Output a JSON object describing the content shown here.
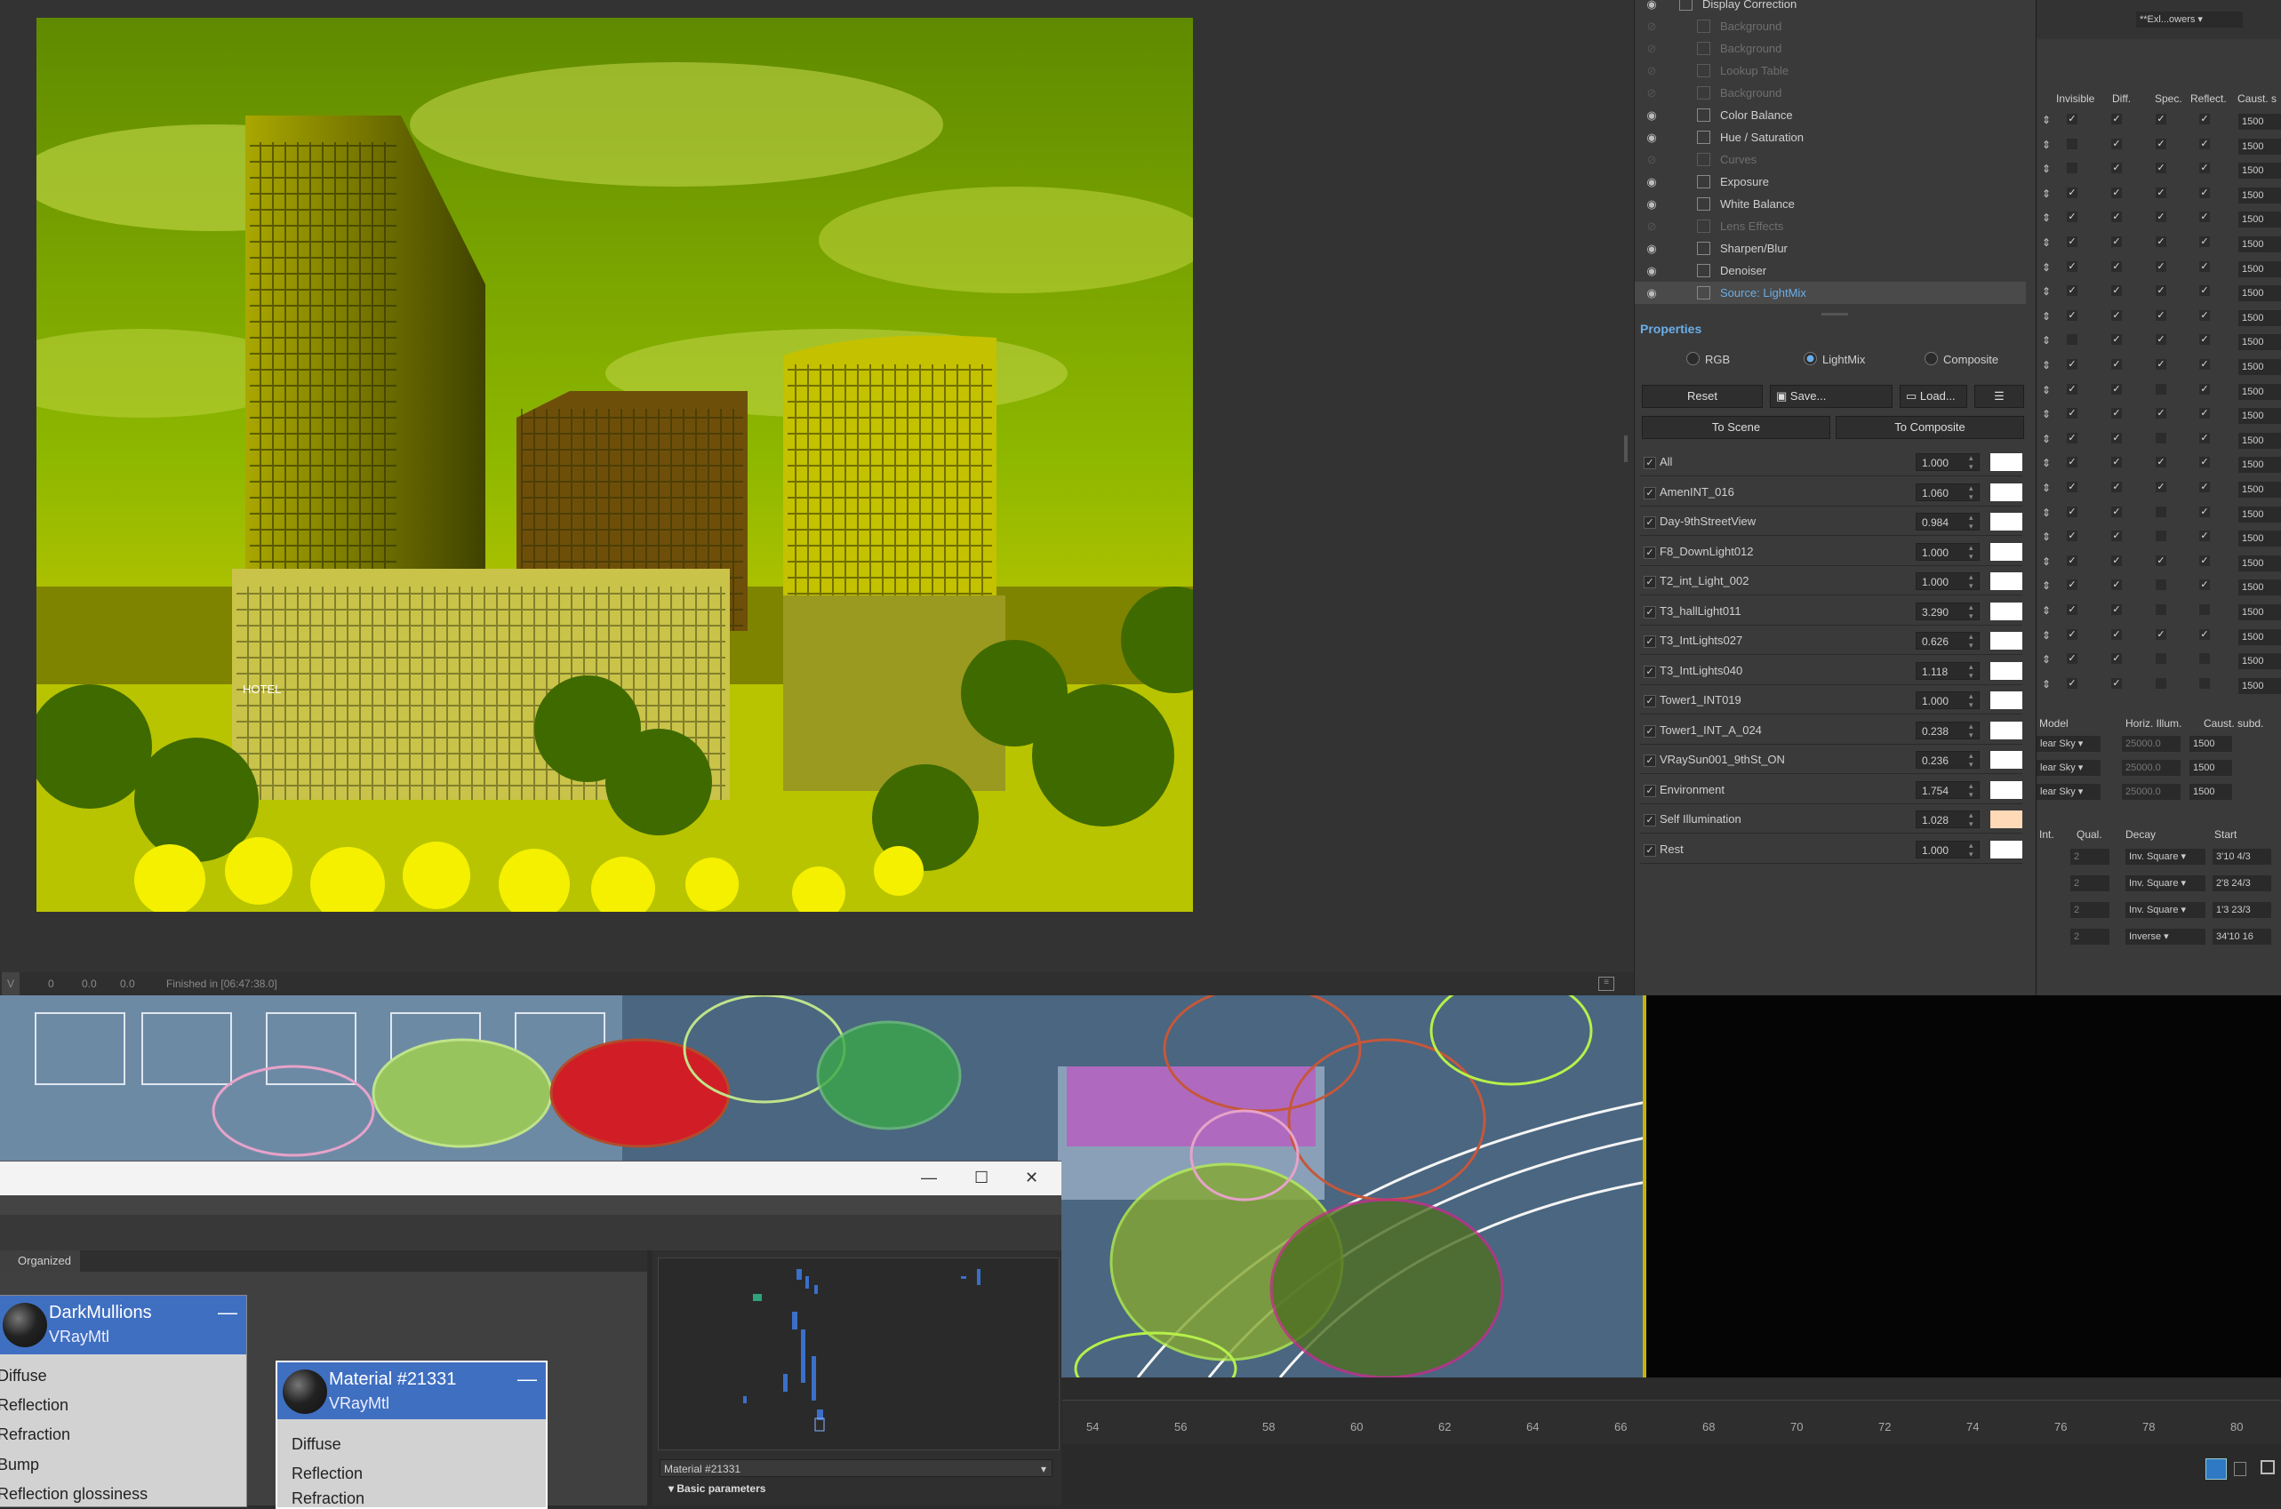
{
  "vfb": {
    "status": {
      "mode": "V",
      "v1": "0",
      "v2": "0.0",
      "v3": "0.0",
      "finished": "Finished in [06:47:38.0]"
    },
    "render_sign": "HOTEL"
  },
  "layers": [
    {
      "name": "Display Correction",
      "visible": true,
      "dim": false
    },
    {
      "name": "Background",
      "visible": false,
      "dim": true
    },
    {
      "name": "Background",
      "visible": false,
      "dim": true
    },
    {
      "name": "Lookup Table",
      "visible": false,
      "dim": true
    },
    {
      "name": "Background",
      "visible": false,
      "dim": true
    },
    {
      "name": "Color Balance",
      "visible": true,
      "dim": false
    },
    {
      "name": "Hue / Saturation",
      "visible": true,
      "dim": false
    },
    {
      "name": "Curves",
      "visible": false,
      "dim": true
    },
    {
      "name": "Exposure",
      "visible": true,
      "dim": false
    },
    {
      "name": "White Balance",
      "visible": true,
      "dim": false
    },
    {
      "name": "Lens Effects",
      "visible": false,
      "dim": true
    },
    {
      "name": "Sharpen/Blur",
      "visible": true,
      "dim": false
    },
    {
      "name": "Denoiser",
      "visible": true,
      "dim": false
    },
    {
      "name": "Source: LightMix",
      "visible": true,
      "dim": false,
      "selected": true
    }
  ],
  "properties": {
    "header": "Properties",
    "modes": [
      "RGB",
      "LightMix",
      "Composite"
    ],
    "selected_mode": "LightMix",
    "buttons": {
      "reset": "Reset",
      "save": "Save...",
      "load": "Load...",
      "to_scene": "To Scene",
      "to_composite": "To Composite"
    },
    "lightmix": [
      {
        "name": "All",
        "value": "1.000",
        "color": "#ffffff"
      },
      {
        "name": "AmenINT_016",
        "value": "1.060",
        "color": "#ffffff"
      },
      {
        "name": "Day-9thStreetView",
        "value": "0.984",
        "color": "#ffffff"
      },
      {
        "name": "F8_DownLight012",
        "value": "1.000",
        "color": "#ffffff"
      },
      {
        "name": "T2_int_Light_002",
        "value": "1.000",
        "color": "#ffffff"
      },
      {
        "name": "T3_hallLight011",
        "value": "3.290",
        "color": "#ffffff"
      },
      {
        "name": "T3_IntLights027",
        "value": "0.626",
        "color": "#ffffff"
      },
      {
        "name": "T3_IntLights040",
        "value": "1.118",
        "color": "#ffffff"
      },
      {
        "name": "Tower1_INT019",
        "value": "1.000",
        "color": "#ffffff"
      },
      {
        "name": "Tower1_INT_A_024",
        "value": "0.238",
        "color": "#ffffff"
      },
      {
        "name": "VRaySun001_9thSt_ON",
        "value": "0.236",
        "color": "#ffffff"
      },
      {
        "name": "Environment",
        "value": "1.754",
        "color": "#ffffff"
      },
      {
        "name": "Self Illumination",
        "value": "1.028",
        "color": "#ffd9b8"
      },
      {
        "name": "Rest",
        "value": "1.000",
        "color": "#ffffff"
      }
    ]
  },
  "lister": {
    "dropdown": "**Exl...owers",
    "headers": [
      "Invisible",
      "Diff.",
      "Spec.",
      "Reflect.",
      "Caust. s"
    ],
    "rows": [
      {
        "inv": true,
        "diff": true,
        "spec": true,
        "refl": true,
        "caust": "1500"
      },
      {
        "inv": false,
        "diff": true,
        "spec": true,
        "refl": true,
        "caust": "1500"
      },
      {
        "inv": false,
        "diff": true,
        "spec": true,
        "refl": true,
        "caust": "1500"
      },
      {
        "inv": true,
        "diff": true,
        "spec": true,
        "refl": true,
        "caust": "1500"
      },
      {
        "inv": true,
        "diff": true,
        "spec": true,
        "refl": true,
        "caust": "1500"
      },
      {
        "inv": true,
        "diff": true,
        "spec": true,
        "refl": true,
        "caust": "1500"
      },
      {
        "inv": true,
        "diff": true,
        "spec": true,
        "refl": true,
        "caust": "1500"
      },
      {
        "inv": true,
        "diff": true,
        "spec": true,
        "refl": true,
        "caust": "1500"
      },
      {
        "inv": true,
        "diff": true,
        "spec": true,
        "refl": true,
        "caust": "1500"
      },
      {
        "inv": false,
        "diff": true,
        "spec": true,
        "refl": true,
        "caust": "1500"
      },
      {
        "inv": true,
        "diff": true,
        "spec": true,
        "refl": true,
        "caust": "1500"
      },
      {
        "inv": true,
        "diff": true,
        "spec": false,
        "refl": true,
        "caust": "1500"
      },
      {
        "inv": true,
        "diff": true,
        "spec": true,
        "refl": true,
        "caust": "1500"
      },
      {
        "inv": true,
        "diff": true,
        "spec": false,
        "refl": true,
        "caust": "1500"
      },
      {
        "inv": true,
        "diff": true,
        "spec": true,
        "refl": true,
        "caust": "1500"
      },
      {
        "inv": true,
        "diff": true,
        "spec": true,
        "refl": true,
        "caust": "1500"
      },
      {
        "inv": true,
        "diff": true,
        "spec": false,
        "refl": true,
        "caust": "1500"
      },
      {
        "inv": true,
        "diff": true,
        "spec": false,
        "refl": true,
        "caust": "1500"
      },
      {
        "inv": true,
        "diff": true,
        "spec": true,
        "refl": true,
        "caust": "1500"
      },
      {
        "inv": true,
        "diff": true,
        "spec": false,
        "refl": true,
        "caust": "1500"
      },
      {
        "inv": true,
        "diff": true,
        "spec": false,
        "refl": false,
        "caust": "1500"
      },
      {
        "inv": true,
        "diff": true,
        "spec": true,
        "refl": true,
        "caust": "1500"
      },
      {
        "inv": true,
        "diff": true,
        "spec": false,
        "refl": false,
        "caust": "1500"
      },
      {
        "inv": true,
        "diff": true,
        "spec": false,
        "refl": false,
        "caust": "1500"
      }
    ],
    "sky_headers": [
      "Model",
      "Horiz. Illum.",
      "Caust. subd."
    ],
    "sky_rows": [
      {
        "model": "lear Sky",
        "horiz": "25000.0",
        "caust": "1500"
      },
      {
        "model": "lear Sky",
        "horiz": "25000.0",
        "caust": "1500"
      },
      {
        "model": "lear Sky",
        "horiz": "25000.0",
        "caust": "1500"
      }
    ],
    "decay_headers": [
      "Int.",
      "Qual.",
      "Decay",
      "Start"
    ],
    "decay_rows": [
      {
        "qual": "2",
        "decay": "Inv. Square",
        "start": "3'10 4/3"
      },
      {
        "qual": "2",
        "decay": "Inv. Square",
        "start": "2'8 24/3"
      },
      {
        "qual": "2",
        "decay": "Inv. Square",
        "start": "1'3 23/3"
      },
      {
        "qual": "2",
        "decay": "Inverse",
        "start": "34'10 16"
      }
    ]
  },
  "timeline": {
    "ticks": [
      "54",
      "56",
      "58",
      "60",
      "62",
      "64",
      "66",
      "68",
      "70",
      "72",
      "74",
      "76",
      "78",
      "80"
    ]
  },
  "material_editor": {
    "tab": "Organized",
    "node1": {
      "title": "DarkMullions",
      "type": "VRayMtl",
      "slots": [
        "Diffuse",
        "Reflection",
        "Refraction",
        "Bump",
        "Reflection glossiness"
      ]
    },
    "node2": {
      "title": "Material #21331",
      "type": "VRayMtl",
      "slots": [
        "Diffuse",
        "Reflection",
        "Refraction"
      ]
    },
    "dropdown": "Material #21331",
    "rollout": "Basic parameters"
  }
}
